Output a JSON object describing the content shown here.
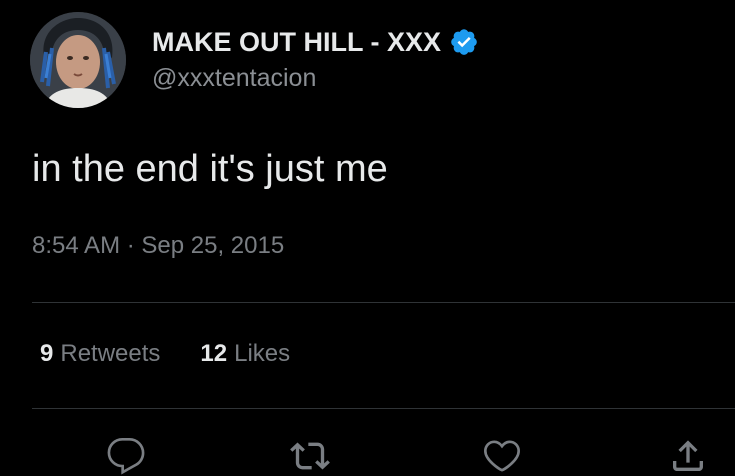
{
  "user": {
    "display_name": "MAKE OUT HILL - XXX",
    "handle": "@xxxtentacion",
    "verified": true,
    "verified_color": "#1d9bf0"
  },
  "tweet": {
    "text": "in the end it's just me",
    "time": "8:54 AM",
    "separator": "·",
    "date": "Sep 25, 2015"
  },
  "stats": {
    "retweets_count": "9",
    "retweets_label": "Retweets",
    "likes_count": "12",
    "likes_label": "Likes"
  },
  "actions": {
    "reply_icon": "reply-icon",
    "retweet_icon": "retweet-icon",
    "like_icon": "heart-icon",
    "share_icon": "share-icon"
  },
  "colors": {
    "background": "#000000",
    "primary_text": "#e7e9ea",
    "secondary_text": "#7a7e83",
    "divider": "#2f3336"
  }
}
